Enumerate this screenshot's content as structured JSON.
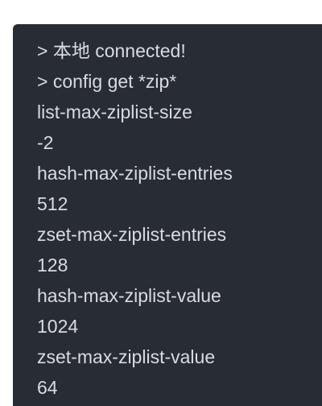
{
  "terminal": {
    "lines": [
      "> 本地 connected!",
      "> config get *zip*",
      "list-max-ziplist-size",
      "-2",
      "hash-max-ziplist-entries",
      "512",
      "zset-max-ziplist-entries",
      "128",
      "hash-max-ziplist-value",
      "1024",
      "zset-max-ziplist-value",
      "64"
    ]
  },
  "colors": {
    "background": "#282c34",
    "text": "#d8dbe1",
    "page": "#ffffff"
  }
}
